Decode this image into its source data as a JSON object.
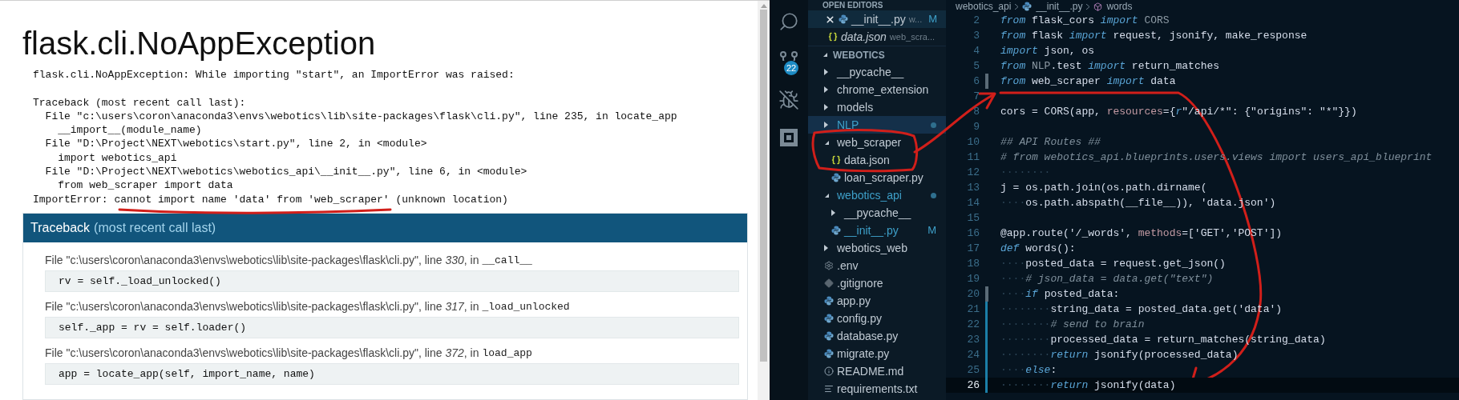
{
  "browser": {
    "title": "flask.cli.NoAppException",
    "message": "flask.cli.NoAppException: While importing \"start\", an ImportError was raised:",
    "traceback_lines": [
      "Traceback (most recent call last):",
      "  File \"c:\\users\\coron\\anaconda3\\envs\\webotics\\lib\\site-packages\\flask\\cli.py\", line 235, in locate_app",
      "    __import__(module_name)",
      "  File \"D:\\Project\\NEXT\\webotics\\start.py\", line 2, in <module>",
      "    import webotics_api",
      "  File \"D:\\Project\\NEXT\\webotics\\webotics_api\\__init__.py\", line 6, in <module>",
      "    from web_scraper import data",
      "ImportError: cannot import name 'data' from 'web_scraper' (unknown location)"
    ],
    "traceback": {
      "title": "Traceback",
      "subtitle": "(most recent call last)",
      "frames": [
        {
          "location": "File \"c:\\users\\coron\\anaconda3\\envs\\webotics\\lib\\site-packages\\flask\\cli.py\", line *330*, in",
          "func": "__call__",
          "code": "rv = self._load_unlocked()"
        },
        {
          "location": "File \"c:\\users\\coron\\anaconda3\\envs\\webotics\\lib\\site-packages\\flask\\cli.py\", line *317*, in",
          "func": "_load_unlocked",
          "code": "self._app = rv = self.loader()"
        },
        {
          "location": "File \"c:\\users\\coron\\anaconda3\\envs\\webotics\\lib\\site-packages\\flask\\cli.py\", line *372*, in",
          "func": "load_app",
          "code": "app = locate_app(self, import_name, name)"
        }
      ]
    }
  },
  "activity_bar": [
    {
      "kind": "search"
    },
    {
      "kind": "source-control",
      "badge": "22"
    },
    {
      "kind": "debug"
    },
    {
      "kind": "extensions"
    }
  ],
  "open_editors": {
    "title": "OPEN EDITORS",
    "items": [
      {
        "name": "__init__.py",
        "description": "w...",
        "badge": "M",
        "kind": "python",
        "preview": false,
        "selected": true
      },
      {
        "name": "data.json",
        "description": "web_scra...",
        "kind": "json",
        "preview": true,
        "selected": false
      }
    ]
  },
  "project": {
    "title": "WEBOTICS",
    "tree": [
      {
        "name": "__pycache__",
        "kind": "folder",
        "expanded": false,
        "modified": false,
        "selected": false
      },
      {
        "name": "chrome_extension",
        "kind": "folder",
        "expanded": false,
        "modified": false,
        "selected": false
      },
      {
        "name": "models",
        "kind": "folder",
        "expanded": false,
        "modified": false,
        "selected": false
      },
      {
        "name": "NLP",
        "kind": "folder",
        "expanded": false,
        "modified": true,
        "selected": true
      },
      {
        "name": "web_scraper",
        "kind": "folder",
        "expanded": true,
        "modified": false,
        "selected": false,
        "children": [
          {
            "name": "data.json",
            "kind": "json",
            "modified": false,
            "selected": false
          },
          {
            "name": "loan_scraper.py",
            "kind": "python",
            "modified": false,
            "selected": false
          }
        ]
      },
      {
        "name": "webotics_api",
        "kind": "folder",
        "expanded": true,
        "modified": true,
        "selected": false,
        "children": [
          {
            "name": "__pycache__",
            "kind": "folder",
            "expanded": false,
            "modified": false,
            "selected": false
          },
          {
            "name": "__init__.py",
            "kind": "python",
            "modified": true,
            "badge": "M",
            "selected": false
          }
        ]
      },
      {
        "name": "webotics_web",
        "kind": "folder",
        "expanded": false,
        "modified": false,
        "selected": false
      },
      {
        "name": ".env",
        "kind": "settings",
        "modified": false,
        "selected": false
      },
      {
        "name": ".gitignore",
        "kind": "git",
        "modified": false,
        "selected": false
      },
      {
        "name": "app.py",
        "kind": "python",
        "modified": false,
        "selected": false
      },
      {
        "name": "config.py",
        "kind": "python",
        "modified": false,
        "selected": false
      },
      {
        "name": "database.py",
        "kind": "python",
        "modified": false,
        "selected": false
      },
      {
        "name": "migrate.py",
        "kind": "python",
        "modified": false,
        "selected": false
      },
      {
        "name": "README.md",
        "kind": "info",
        "modified": false,
        "selected": false
      },
      {
        "name": "requirements.txt",
        "kind": "text",
        "modified": false,
        "selected": false
      }
    ]
  },
  "editor": {
    "breadcrumb": [
      {
        "text": "webotics_api",
        "kind": "folder"
      },
      {
        "text": "__init__.py",
        "kind": "python"
      },
      {
        "text": "words",
        "kind": "symbol"
      }
    ],
    "lines": [
      {
        "number": "2",
        "selected": false,
        "modified": false,
        "added": false,
        "tokens": [
          {
            "kind": "kw",
            "text": "from"
          },
          {
            "kind": "txt",
            "text": " flask_cors "
          },
          {
            "kind": "kw",
            "text": "import"
          },
          {
            "kind": "dim",
            "text": " CORS"
          }
        ]
      },
      {
        "number": "3",
        "selected": false,
        "modified": false,
        "added": false,
        "tokens": [
          {
            "kind": "kw",
            "text": "from"
          },
          {
            "kind": "txt",
            "text": " flask "
          },
          {
            "kind": "kw",
            "text": "import"
          },
          {
            "kind": "txt",
            "text": " request, jsonify, make_response"
          }
        ]
      },
      {
        "number": "4",
        "selected": false,
        "modified": false,
        "added": false,
        "tokens": [
          {
            "kind": "kw",
            "text": "import"
          },
          {
            "kind": "txt",
            "text": " json, os"
          }
        ]
      },
      {
        "number": "5",
        "selected": false,
        "modified": false,
        "added": false,
        "tokens": [
          {
            "kind": "kw",
            "text": "from"
          },
          {
            "kind": "dim",
            "text": " NLP"
          },
          {
            "kind": "txt",
            "text": ".test "
          },
          {
            "kind": "kw",
            "text": "import"
          },
          {
            "kind": "txt",
            "text": " return_matches"
          }
        ]
      },
      {
        "number": "6",
        "selected": false,
        "modified": true,
        "added": false,
        "tokens": [
          {
            "kind": "kw",
            "text": "from"
          },
          {
            "kind": "txt",
            "text": " web_scraper "
          },
          {
            "kind": "kw",
            "text": "import"
          },
          {
            "kind": "txt",
            "text": " data"
          }
        ]
      },
      {
        "number": "7",
        "selected": false,
        "modified": false,
        "added": false
      },
      {
        "number": "8",
        "selected": false,
        "modified": false,
        "added": false,
        "tokens": [
          {
            "kind": "txt",
            "text": "cors = CORS(app, "
          },
          {
            "kind": "param",
            "text": "resources"
          },
          {
            "kind": "txt",
            "text": "={"
          },
          {
            "kind": "kw",
            "text": "r"
          },
          {
            "kind": "txt",
            "text": "\"/api/*\": {\"origins\": \"*\"}})"
          }
        ]
      },
      {
        "number": "9",
        "selected": false,
        "modified": false,
        "added": false
      },
      {
        "number": "10",
        "selected": false,
        "modified": false,
        "added": false,
        "tokens": [
          {
            "kind": "cmt",
            "text": "## API Routes ##"
          }
        ]
      },
      {
        "number": "11",
        "selected": false,
        "modified": false,
        "added": false,
        "tokens": [
          {
            "kind": "cmt",
            "text": "# from webotics_api.blueprints.users.views import users_api_blueprint"
          }
        ]
      },
      {
        "number": "12",
        "selected": false,
        "modified": false,
        "added": false,
        "tokens": [
          {
            "kind": "ws",
            "text": "········"
          }
        ]
      },
      {
        "number": "13",
        "selected": false,
        "modified": false,
        "added": false,
        "tokens": [
          {
            "kind": "txt",
            "text": "j = os.path.join(os.path.dirname("
          }
        ]
      },
      {
        "number": "14",
        "selected": false,
        "modified": false,
        "added": false,
        "tokens": [
          {
            "kind": "ws",
            "text": "····"
          },
          {
            "kind": "txt",
            "text": "os.path.abspath(__file__)), 'data.json')"
          }
        ]
      },
      {
        "number": "15",
        "selected": false,
        "modified": false,
        "added": false
      },
      {
        "number": "16",
        "selected": false,
        "modified": false,
        "added": false,
        "tokens": [
          {
            "kind": "txt",
            "text": "@app.route('/_words', "
          },
          {
            "kind": "param",
            "text": "methods"
          },
          {
            "kind": "txt",
            "text": "=['GET','POST'])"
          }
        ]
      },
      {
        "number": "17",
        "selected": false,
        "modified": false,
        "added": false,
        "tokens": [
          {
            "kind": "kw",
            "text": "def"
          },
          {
            "kind": "txt",
            "text": " words():"
          }
        ]
      },
      {
        "number": "18",
        "selected": false,
        "modified": false,
        "added": false,
        "tokens": [
          {
            "kind": "ws",
            "text": "····"
          },
          {
            "kind": "txt",
            "text": "posted_data = request.get_json()"
          }
        ]
      },
      {
        "number": "19",
        "selected": false,
        "modified": false,
        "added": false,
        "tokens": [
          {
            "kind": "ws",
            "text": "····"
          },
          {
            "kind": "cmt",
            "text": "# json_data = data.get(\"text\")"
          }
        ]
      },
      {
        "number": "20",
        "selected": false,
        "modified": true,
        "added": false,
        "tokens": [
          {
            "kind": "ws",
            "text": "····"
          },
          {
            "kind": "kw",
            "text": "if"
          },
          {
            "kind": "txt",
            "text": " posted_data:"
          }
        ]
      },
      {
        "number": "21",
        "selected": false,
        "modified": false,
        "added": true,
        "tokens": [
          {
            "kind": "ws",
            "text": "········"
          },
          {
            "kind": "txt",
            "text": "string_data = posted_data.get('data')"
          }
        ]
      },
      {
        "number": "22",
        "selected": false,
        "modified": false,
        "added": true,
        "tokens": [
          {
            "kind": "ws",
            "text": "········"
          },
          {
            "kind": "cmt",
            "text": "# send to brain"
          }
        ]
      },
      {
        "number": "23",
        "selected": false,
        "modified": false,
        "added": true,
        "tokens": [
          {
            "kind": "ws",
            "text": "········"
          },
          {
            "kind": "txt",
            "text": "processed_data = return_matches(string_data)"
          }
        ]
      },
      {
        "number": "24",
        "selected": false,
        "modified": false,
        "added": true,
        "tokens": [
          {
            "kind": "ws",
            "text": "········"
          },
          {
            "kind": "kw",
            "text": "return"
          },
          {
            "kind": "txt",
            "text": " jsonify(processed_data)"
          }
        ]
      },
      {
        "number": "25",
        "selected": false,
        "modified": false,
        "added": true,
        "tokens": [
          {
            "kind": "ws",
            "text": "····"
          },
          {
            "kind": "kw",
            "text": "else"
          },
          {
            "kind": "txt",
            "text": ":"
          }
        ]
      },
      {
        "number": "26",
        "selected": true,
        "modified": false,
        "added": true,
        "tokens": [
          {
            "kind": "ws",
            "text": "········"
          },
          {
            "kind": "kw",
            "text": "return"
          },
          {
            "kind": "txt",
            "text": " jsonify(data)"
          }
        ]
      }
    ]
  }
}
